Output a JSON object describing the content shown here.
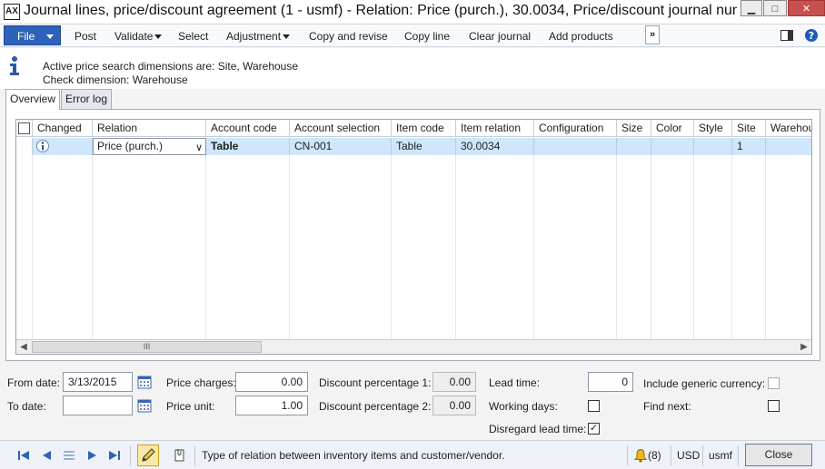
{
  "window": {
    "app_icon": "AX",
    "title": "Journal lines, price/discount agreement (1 - usmf) - Relation: Price (purch.), 30.0034, Price/discount journal number: PD...",
    "minimize_glyph": "▁",
    "maximize_glyph": "□",
    "close_glyph": "✕"
  },
  "action_pane": {
    "file": "File",
    "items": [
      "Post",
      "Validate",
      "Select",
      "Adjustment",
      "Copy and revise",
      "Copy line",
      "Clear journal",
      "Add products"
    ],
    "overflow": "»"
  },
  "info": {
    "line1": "Active price search dimensions are: Site, Warehouse",
    "line2": "Check dimension: Warehouse"
  },
  "tabs": [
    "Overview",
    "Error log"
  ],
  "grid": {
    "headers": [
      "Changed",
      "Relation",
      "Account code",
      "Account selection",
      "Item code",
      "Item relation",
      "Configuration",
      "Size",
      "Color",
      "Style",
      "Site",
      "Warehou"
    ],
    "row": {
      "relation": "Price (purch.)",
      "account_code": "Table",
      "account_selection": "CN-001",
      "item_code": "Table",
      "item_relation": "30.0034",
      "configuration": "",
      "size": "",
      "color": "",
      "style": "",
      "site": "1",
      "warehouse": ""
    },
    "scroll_left": "◀",
    "scroll_right": "▶",
    "scroll_thumb": "III"
  },
  "fields": {
    "from_date_label": "From date:",
    "from_date": "3/13/2015",
    "to_date_label": "To date:",
    "to_date": "",
    "price_charges_label": "Price charges:",
    "price_charges": "0.00",
    "price_unit_label": "Price unit:",
    "price_unit": "1.00",
    "discount_pct1_label": "Discount percentage 1:",
    "discount_pct1": "0.00",
    "discount_pct2_label": "Discount percentage 2:",
    "discount_pct2": "0.00",
    "lead_time_label": "Lead time:",
    "lead_time": "0",
    "working_days_label": "Working days:",
    "disregard_lead_time_label": "Disregard lead time:",
    "disregard_lead_time_mark": "✓",
    "include_generic_currency_label": "Include generic currency:",
    "find_next_label": "Find next:"
  },
  "status": {
    "message": "Type of relation between inventory items and customer/vendor.",
    "notifications": "(8)",
    "currency": "USD",
    "company": "usmf",
    "close": "Close"
  },
  "colors": {
    "accent": "#2d62b8",
    "selected_row": "#cfe6fb"
  }
}
